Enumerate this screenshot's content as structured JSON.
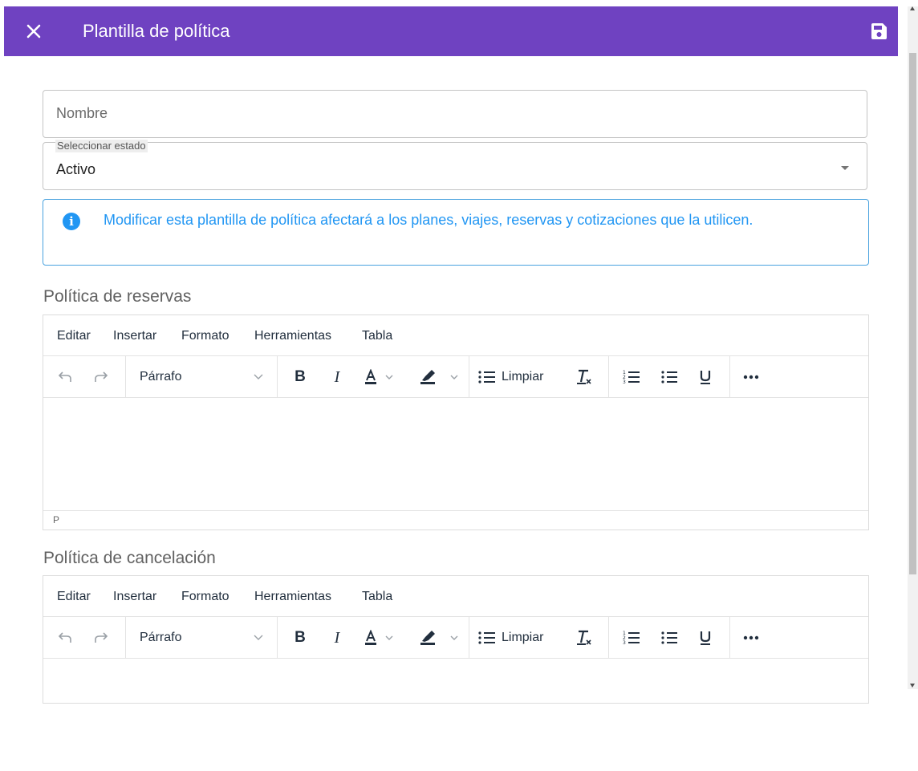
{
  "header": {
    "title": "Plantilla de política",
    "close_icon": "close-icon",
    "save_icon": "floppy-disk-save-icon",
    "bar_color": "#6f42c1"
  },
  "form": {
    "name_placeholder": "Nombre",
    "name_value": "",
    "status_label": "Seleccionar estado",
    "status_value": "Activo"
  },
  "alert": {
    "icon": "info-icon",
    "text": "Modificar esta plantilla de política afectará a los planes, viajes, reservas y cotizaciones que la utilicen.",
    "color": "#2196f3"
  },
  "editors": [
    {
      "title": "Política de reservas",
      "menu": [
        "Editar",
        "Insertar",
        "Formato",
        "Herramientas",
        "Tabla"
      ],
      "block_format": "Párrafo",
      "clear_label": "Limpiar",
      "status_path": "P"
    },
    {
      "title": "Política de cancelación",
      "menu": [
        "Editar",
        "Insertar",
        "Formato",
        "Herramientas",
        "Tabla"
      ],
      "block_format": "Párrafo",
      "clear_label": "Limpiar"
    }
  ]
}
